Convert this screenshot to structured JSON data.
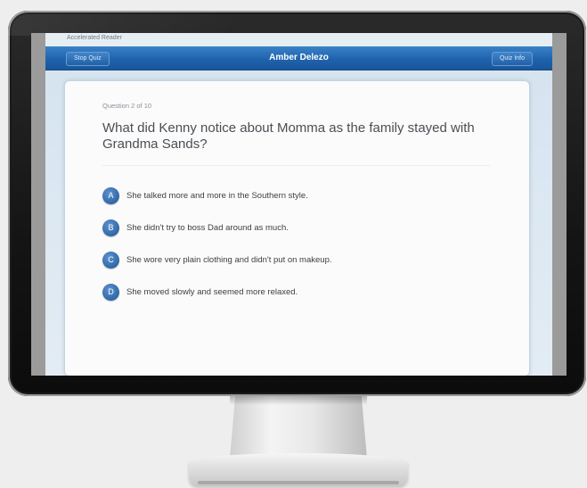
{
  "app": {
    "name": "Accelerated Reader"
  },
  "toolbar": {
    "stop_label": "Stop Quiz",
    "student_name": "Amber Delezo",
    "info_label": "Quiz Info"
  },
  "quiz": {
    "progress": "Question 2 of 10",
    "question": "What did Kenny notice about Momma as the family stayed with Grandma Sands?",
    "answers": [
      {
        "letter": "A",
        "text": "She talked more and more in the Southern style."
      },
      {
        "letter": "B",
        "text": "She didn't try to boss Dad around as much."
      },
      {
        "letter": "C",
        "text": "She wore very plain clothing and didn't put on makeup."
      },
      {
        "letter": "D",
        "text": "She moved slowly and seemed more relaxed."
      }
    ]
  },
  "colors": {
    "toolbar_blue": "#1f63ad",
    "badge_blue": "#2f67a8",
    "card_bg": "#fbfbfb"
  }
}
